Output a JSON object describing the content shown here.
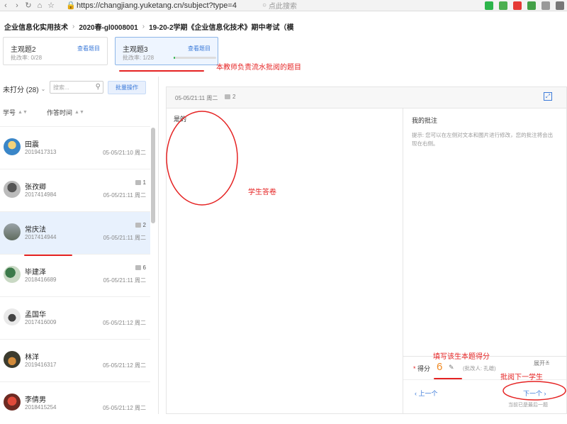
{
  "browser": {
    "url": "https://changjiang.yuketang.cn/subject?type=4",
    "search_placeholder": "点此搜索"
  },
  "breadcrumb": [
    "企业信息化实用技术",
    "2020春-gl0008001",
    "19-20-2学期《企业信息化技术》期中考试（模"
  ],
  "question_tabs": [
    {
      "name": "主观题2",
      "rate": "批改率: 0/28",
      "view": "查看题目",
      "progress": 0
    },
    {
      "name": "主观题3",
      "rate": "批改率: 1/28",
      "view": "查看题目",
      "progress": 0.04
    }
  ],
  "annotations": {
    "tab_note": "本教师负责流水批阅的题目",
    "answer_note": "学生答卷",
    "score_note": "填写该生本题得分",
    "next_note": "批阅下一学生"
  },
  "left": {
    "filter": "未打分 (28)",
    "search_placeholder": "搜索...",
    "batch": "批量操作",
    "col_id": "学号",
    "col_time": "作答时间"
  },
  "students": [
    {
      "name": "田震",
      "id": "2019417313",
      "time": "05-05/21:10 周二",
      "count": ""
    },
    {
      "name": "张孜卿",
      "id": "2017414984",
      "time": "05-05/21:11 周二",
      "count": "1"
    },
    {
      "name": "常庆法",
      "id": "2017414944",
      "time": "05-05/21:11 周二",
      "count": "2"
    },
    {
      "name": "毕建泽",
      "id": "2018416689",
      "time": "05-05/21:11 周二",
      "count": "6"
    },
    {
      "name": "孟国华",
      "id": "2017416009",
      "time": "05-05/21:12 周二",
      "count": ""
    },
    {
      "name": "林洋",
      "id": "2019416317",
      "time": "05-05/21:12 周二",
      "count": ""
    },
    {
      "name": "李倩男",
      "id": "2018415254",
      "time": "05-05/21:12 周二",
      "count": ""
    }
  ],
  "panel": {
    "time": "05-05/21:11 周二",
    "count": "2",
    "answer": "是的",
    "notes_title": "我的批注",
    "notes_hint": "提示: 您可以在左侧对文本和图片进行修改，您的批注将会出现在右侧。",
    "score_label": "得分",
    "score": "6",
    "grader": "(批改人: 孔雄)",
    "expand": "展开",
    "prev": "上一个",
    "next": "下一个",
    "last_note": "当前已是最后一题"
  }
}
